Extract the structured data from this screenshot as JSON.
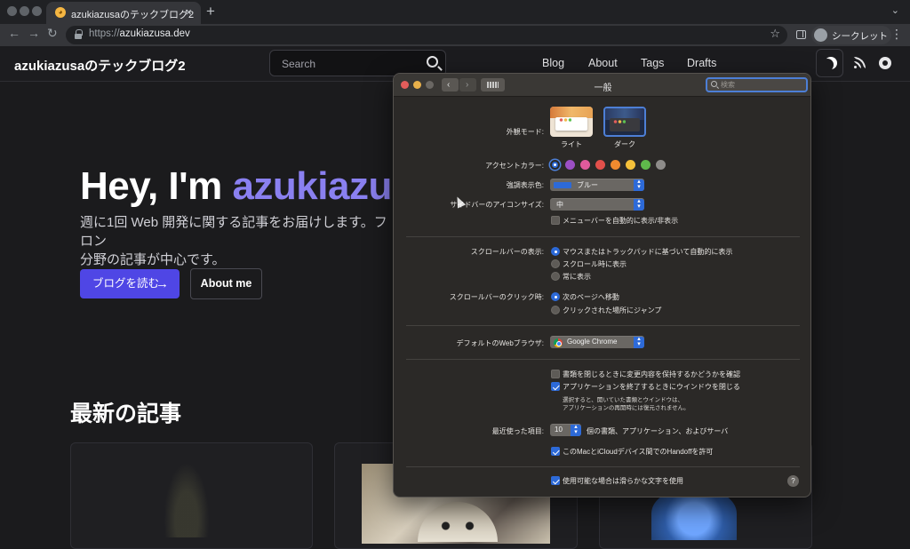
{
  "browser": {
    "tab_title": "azukiazusaのテックブログ2",
    "new_tab": "+",
    "url_scheme": "https://",
    "url_host": "azukiazusa.dev",
    "incognito_label": "シークレット"
  },
  "site": {
    "brand": "azukiazusaのテックブログ2",
    "search_placeholder": "Search",
    "nav": [
      "Blog",
      "About",
      "Tags",
      "Drafts"
    ],
    "hero_prefix": "Hey, I'm ",
    "hero_accent": "azukiazus",
    "hero_accent_suffix": "a",
    "hero_subtitle": "週に1回 Web 開発に関する記事をお届けします。フロン ト・エンド 分野の記事が中心です。",
    "hero_subtitle_line1": "週に1回 Web 開発に関する記事をお届けします。フロン",
    "hero_subtitle_line2": "分野の記事が中心です。",
    "cta_primary": "ブログを読む",
    "cta_arrow": "→",
    "cta_secondary": "About me",
    "latest_heading": "最新の記事"
  },
  "prefs": {
    "title": "一般",
    "search_placeholder": "検索",
    "appearance_label": "外観モード:",
    "appearance_options": [
      "ライト",
      "ダーク"
    ],
    "appearance_selected": "ダーク",
    "accent_label": "アクセントカラー:",
    "accent_colors": [
      "#2d6ad8",
      "#9b4fc4",
      "#e05a9c",
      "#e2504b",
      "#f08a2f",
      "#f4c03a",
      "#5fb94b",
      "#8e8c8a"
    ],
    "accent_selected_index": 0,
    "highlight_label": "強調表示色:",
    "highlight_value": "ブルー",
    "sidebar_icon_label": "サイドバーのアイコンサイズ:",
    "sidebar_icon_value": "中",
    "menubar_autohide": "メニューバーを自動的に表示/非表示",
    "menubar_autohide_checked": false,
    "scrollbar_label": "スクロールバーの表示:",
    "scrollbar_options": [
      "マウスまたはトラックパッドに基づいて自動的に表示",
      "スクロール時に表示",
      "常に表示"
    ],
    "scrollbar_selected_index": 0,
    "scrollclick_label": "スクロールバーのクリック時:",
    "scrollclick_options": [
      "次のページへ移動",
      "クリックされた場所にジャンプ"
    ],
    "scrollclick_selected_index": 0,
    "browser_label": "デフォルトのWebブラウザ:",
    "browser_value": "Google Chrome",
    "ask_keep_changes": "書類を閉じるときに変更内容を保持するかどうかを確認",
    "ask_keep_changes_checked": false,
    "close_windows": "アプリケーションを終了するときにウインドウを閉じる",
    "close_windows_checked": true,
    "close_windows_note_1": "選択すると、開いていた書類とウインドウは、",
    "close_windows_note_2": "アプリケーションの再開時には復元されません。",
    "recent_label": "最近使った項目:",
    "recent_value": "10",
    "recent_suffix": "個の書類、アプリケーション、およびサーバ",
    "handoff": "このMacとiCloudデバイス間でのHandoffを許可",
    "handoff_checked": true,
    "font_smoothing": "使用可能な場合は滑らかな文字を使用",
    "font_smoothing_checked": true,
    "help": "?"
  }
}
